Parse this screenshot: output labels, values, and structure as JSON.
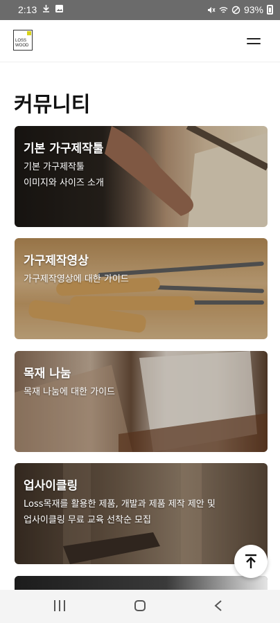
{
  "status_bar": {
    "time": "2:13",
    "battery": "93%",
    "icons": [
      "download-icon",
      "image-icon",
      "mute-icon",
      "wifi-icon",
      "dnd-icon",
      "battery-icon"
    ]
  },
  "header": {
    "logo_text": "LOSS WOOD"
  },
  "page": {
    "title": "커뮤니티"
  },
  "cards": [
    {
      "title": "기본 가구제작툴",
      "desc": "기본 가구제작툴\n이미지와 사이즈 소개"
    },
    {
      "title": "가구제작영상",
      "desc": "가구제작영상에 대한 가이드"
    },
    {
      "title": "목재 나눔",
      "desc": "목재 나눔에 대한 가이드"
    },
    {
      "title": "업사이클링",
      "desc": "Loss목재를 활용한 제품, 개발과 제품 제작 제안 및\n업사이클링 무료 교육 선착순 모집"
    }
  ],
  "colors": {
    "status_bar": "#6b6b6b",
    "text_primary": "#111111",
    "logo_accent": "#d8d21a"
  }
}
